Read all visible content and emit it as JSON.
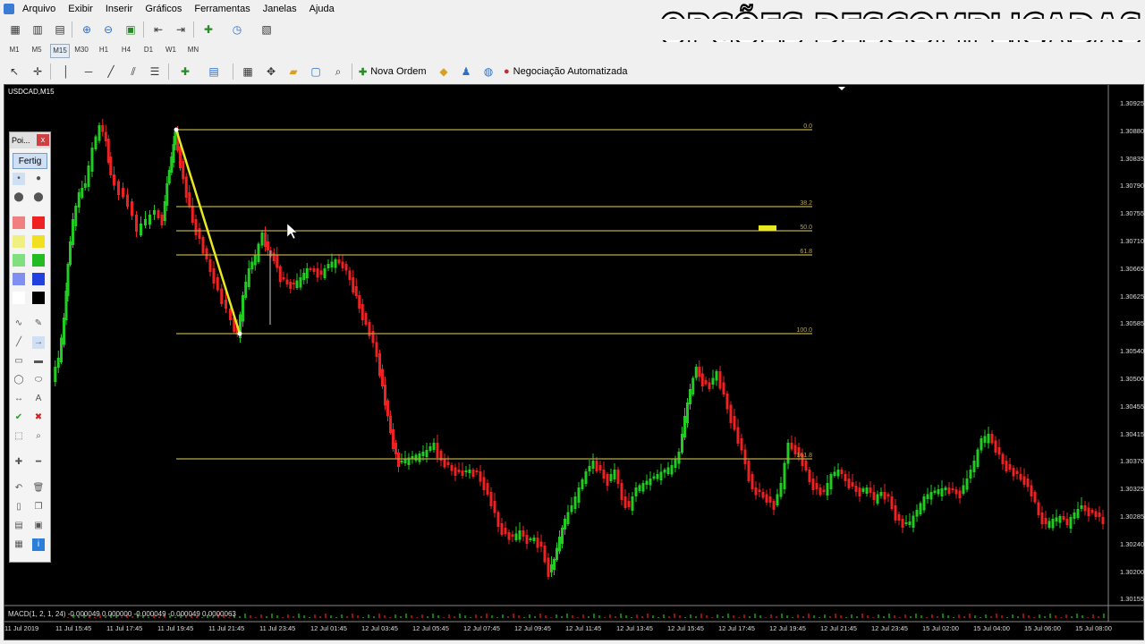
{
  "menu": [
    "Arquivo",
    "Exibir",
    "Inserir",
    "Gráficos",
    "Ferramentas",
    "Janelas",
    "Ajuda"
  ],
  "brand": "OPÇÕES DESCOMPLICADAS",
  "timeframes": [
    "M1",
    "M5",
    "M15",
    "M30",
    "H1",
    "H4",
    "D1",
    "W1",
    "MN"
  ],
  "active_timeframe": "M15",
  "toolbar3": {
    "new_order": "Nova Ordem",
    "auto_trading": "Negociação Automatizada"
  },
  "chart": {
    "symbol": "USDCAD,M15",
    "macd_label": "MACD(1, 2, 1, 24) -0.000049 0.000000 -0.000049 -0.000049 0.0000063",
    "price_axis": [
      "1.30925",
      "1.30880",
      "1.30835",
      "1.30790",
      "1.30755",
      "1.30710",
      "1.30665",
      "1.30625",
      "1.30585",
      "1.30540",
      "1.30500",
      "1.30455",
      "1.30415",
      "1.30370",
      "1.30325",
      "1.30285",
      "1.30240",
      "1.30200",
      "1.30155"
    ],
    "time_axis": [
      "11 Jul 2019",
      "11 Jul 15:45",
      "11 Jul 17:45",
      "11 Jul 19:45",
      "11 Jul 21:45",
      "11 Jul 23:45",
      "12 Jul 01:45",
      "12 Jul 03:45",
      "12 Jul 05:45",
      "12 Jul 07:45",
      "12 Jul 09:45",
      "12 Jul 11:45",
      "12 Jul 13:45",
      "12 Jul 15:45",
      "12 Jul 17:45",
      "12 Jul 19:45",
      "12 Jul 21:45",
      "12 Jul 23:45",
      "15 Jul 02:00",
      "15 Jul 04:00",
      "15 Jul 06:00",
      "15 Jul 08:00"
    ],
    "fib_levels": [
      "0.0",
      "38.2",
      "50.0",
      "61.8",
      "100.0",
      "161.8"
    ],
    "colors": {
      "bull": "#22cc22",
      "bear": "#ee2222",
      "fib": "#b8a848",
      "trend": "#e8e820"
    }
  },
  "palette": {
    "title": "Poi...",
    "close": "x",
    "button": "Fertig"
  }
}
